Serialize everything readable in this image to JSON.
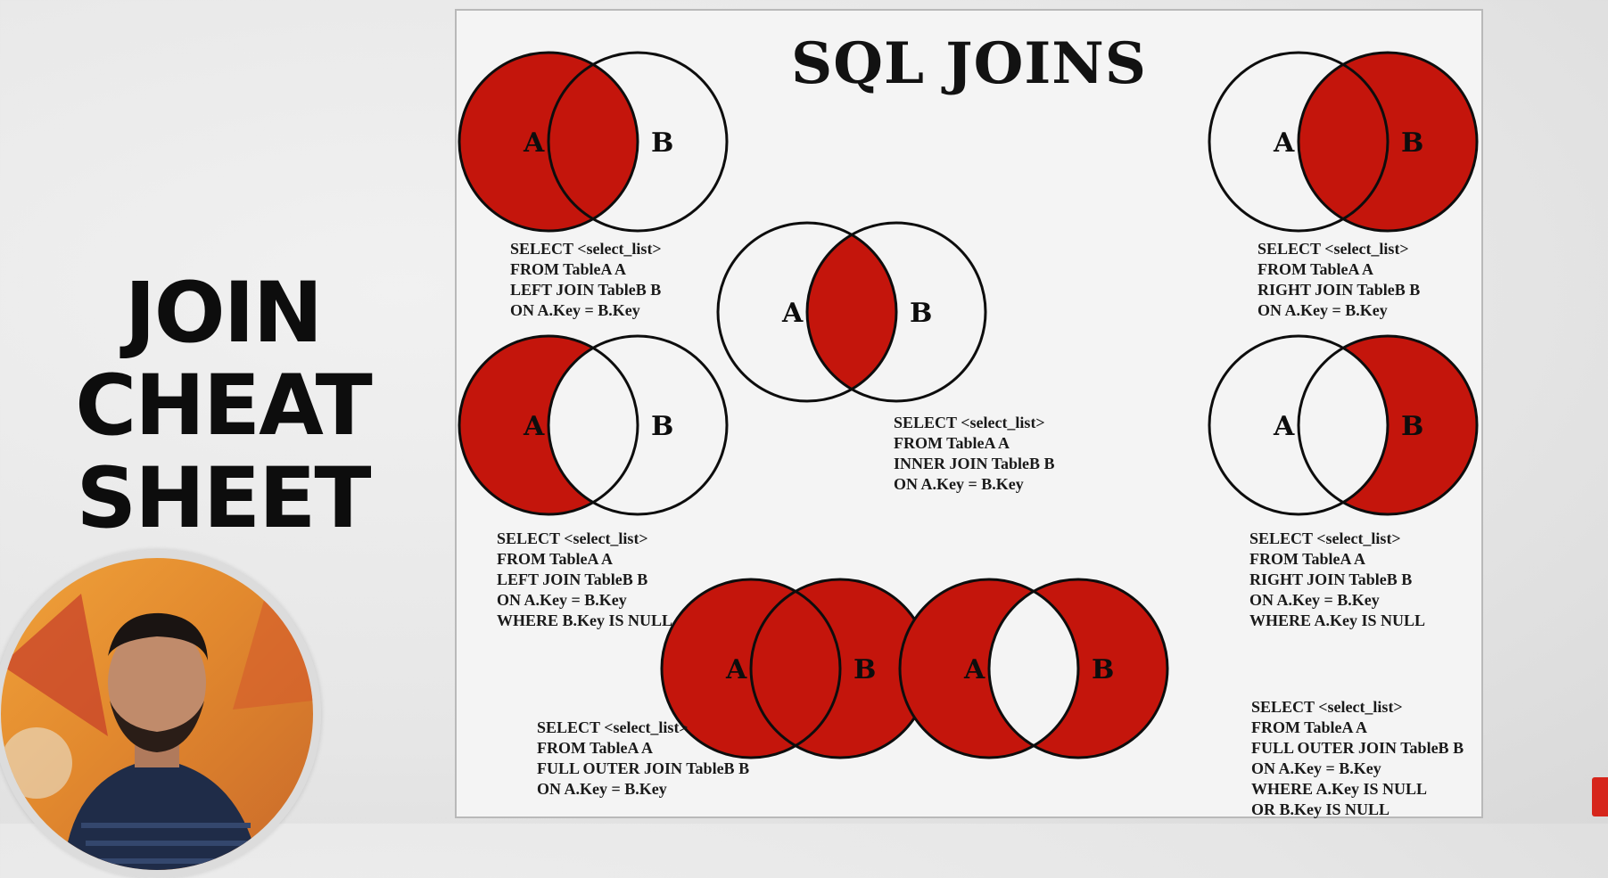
{
  "left": {
    "title_lines": [
      "JOIN",
      "CHEAT",
      "SHEET"
    ]
  },
  "sheet": {
    "title": "SQL JOINS",
    "fill_color": "#c4150c",
    "outline_color": "#0d0d0d",
    "circle_label_a": "A",
    "circle_label_b": "B",
    "queries": {
      "left_join": [
        "SELECT <select_list>",
        "FROM TableA A",
        "LEFT JOIN TableB B",
        "ON A.Key = B.Key"
      ],
      "inner_join": [
        "SELECT <select_list>",
        "FROM TableA A",
        "INNER JOIN TableB B",
        "ON A.Key = B.Key"
      ],
      "right_join": [
        "SELECT <select_list>",
        "FROM TableA A",
        "RIGHT JOIN TableB B",
        "ON A.Key = B.Key"
      ],
      "left_excl": [
        "SELECT <select_list>",
        "FROM TableA A",
        "LEFT JOIN TableB B",
        "ON A.Key = B.Key",
        "WHERE B.Key IS NULL"
      ],
      "right_excl": [
        "SELECT <select_list>",
        "FROM TableA A",
        "RIGHT JOIN TableB B",
        "ON A.Key = B.Key",
        "WHERE A.Key IS NULL"
      ],
      "full_outer": [
        "SELECT <select_list>",
        "FROM TableA A",
        "FULL OUTER JOIN TableB B",
        "ON A.Key = B.Key"
      ],
      "full_outer_excl": [
        "SELECT <select_list>",
        "FROM TableA A",
        "FULL OUTER JOIN TableB B",
        "ON A.Key = B.Key",
        "WHERE A.Key IS NULL",
        "OR B.Key IS NULL"
      ]
    }
  }
}
